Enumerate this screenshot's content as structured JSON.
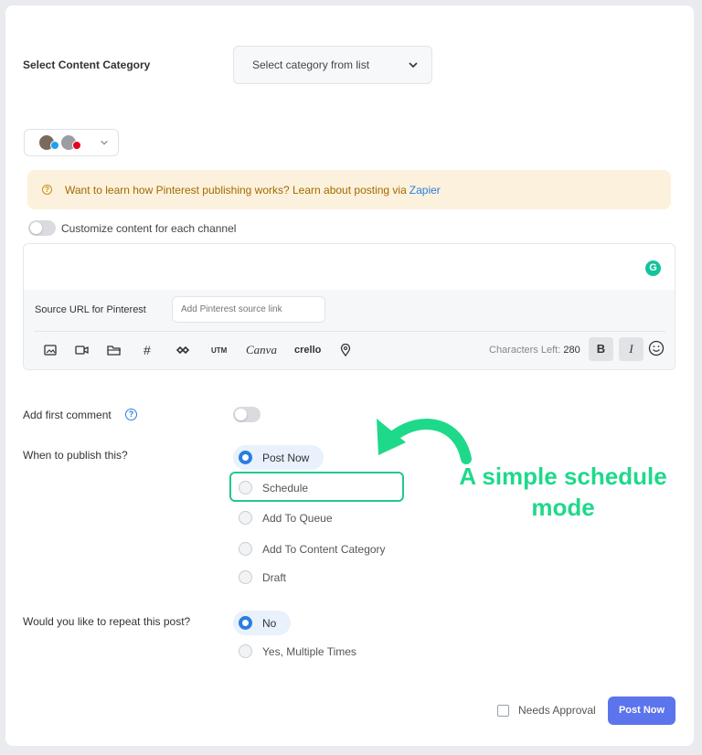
{
  "category": {
    "label": "Select Content Category",
    "dropdown_value": "Select category from list"
  },
  "notice": {
    "text": "Want to learn how Pinterest publishing works? Learn about posting via",
    "link": "Zapier"
  },
  "customize_label": "Customize content for each channel",
  "editor": {
    "source_label": "Source URL for Pinterest",
    "source_placeholder": "Add Pinterest source link",
    "tools": {
      "utm": "UTM",
      "canva": "Canva",
      "crello": "crello"
    },
    "chars_label": "Characters Left:",
    "chars_value": "280",
    "bold": "B",
    "italic": "I",
    "grammarly": "G"
  },
  "first_comment": {
    "label": "Add first comment"
  },
  "publish": {
    "label": "When to publish this?",
    "options": [
      "Post Now",
      "Schedule",
      "Add To Queue",
      "Add To Content Category",
      "Draft"
    ],
    "selected": "Post Now"
  },
  "repeat": {
    "label": "Would you like to repeat this post?",
    "options": [
      "No",
      "Yes, Multiple Times"
    ],
    "selected": "No"
  },
  "annotation": {
    "line1": "A simple schedule",
    "line2": "mode"
  },
  "footer": {
    "needs_approval": "Needs Approval",
    "post_now": "Post Now"
  },
  "colors": {
    "accent": "#2a7ee0",
    "button": "#5c74ec",
    "annotation": "#1ed98a",
    "notice_bg": "#fcf1dc"
  }
}
